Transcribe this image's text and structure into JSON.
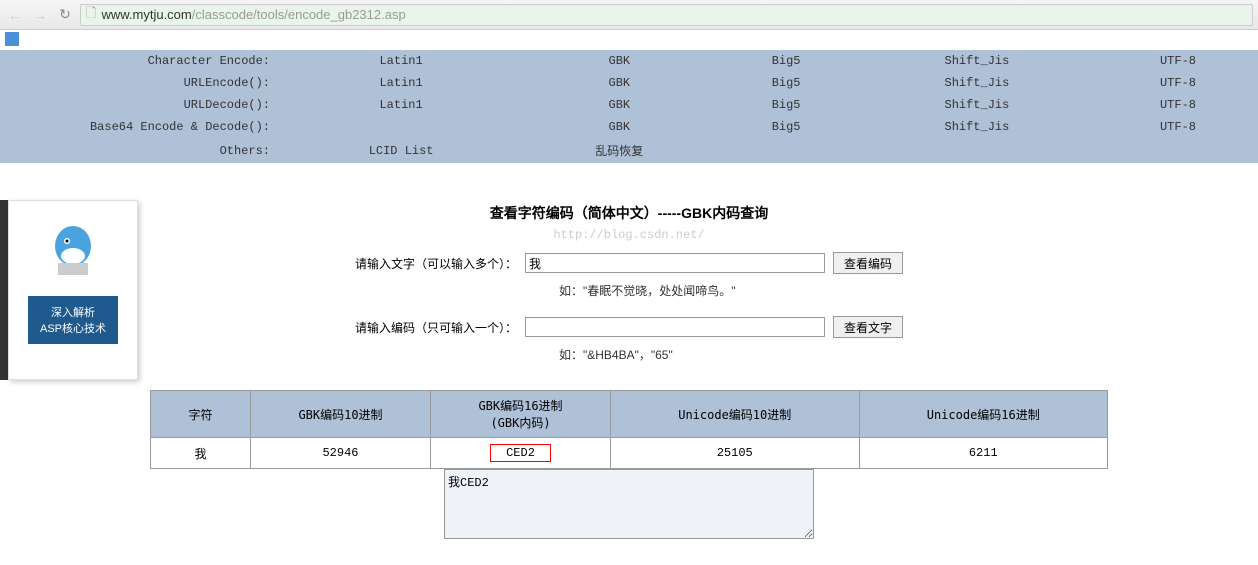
{
  "browser": {
    "url_domain": "www.mytju.com",
    "url_path": "/classcode/tools/encode_gb2312.asp"
  },
  "nav": {
    "rows": [
      {
        "label": "Character Encode:",
        "cells": [
          "Latin1",
          "GBK",
          "Big5",
          "Shift_Jis",
          "UTF-8"
        ]
      },
      {
        "label": "URLEncode():",
        "cells": [
          "Latin1",
          "GBK",
          "Big5",
          "Shift_Jis",
          "UTF-8"
        ]
      },
      {
        "label": "URLDecode():",
        "cells": [
          "Latin1",
          "GBK",
          "Big5",
          "Shift_Jis",
          "UTF-8"
        ]
      },
      {
        "label": "Base64 Encode & Decode():",
        "cells": [
          "",
          "GBK",
          "Big5",
          "Shift_Jis",
          "UTF-8"
        ]
      },
      {
        "label": "Others:",
        "cells": [
          "LCID List",
          "乱码恢复",
          "",
          "",
          ""
        ]
      }
    ]
  },
  "book": {
    "title_line1": "深入解析",
    "title_line2": "ASP核心技术"
  },
  "page": {
    "title": "查看字符编码（简体中文）-----GBK内码查询",
    "watermark": "http://blog.csdn.net/",
    "input1_label": "请输入文字（可以输入多个）：",
    "input1_value": "我",
    "btn1": "查看编码",
    "hint1": "如：\"春眠不觉晓，处处闻啼鸟。\"",
    "input2_label": "请输入编码（只可输入一个）：",
    "input2_value": "",
    "btn2": "查看文字",
    "hint2": "如：\"&HB4BA\"，\"65\""
  },
  "table": {
    "headers": [
      "字符",
      "GBK编码10进制",
      "GBK编码16进制\n(GBK内码)",
      "Unicode编码10进制",
      "Unicode编码16进制"
    ],
    "rows": [
      {
        "char": "我",
        "gbk10": "52946",
        "gbk16": "CED2",
        "uni10": "25105",
        "uni16": "6211"
      }
    ]
  },
  "output": "我CED2"
}
